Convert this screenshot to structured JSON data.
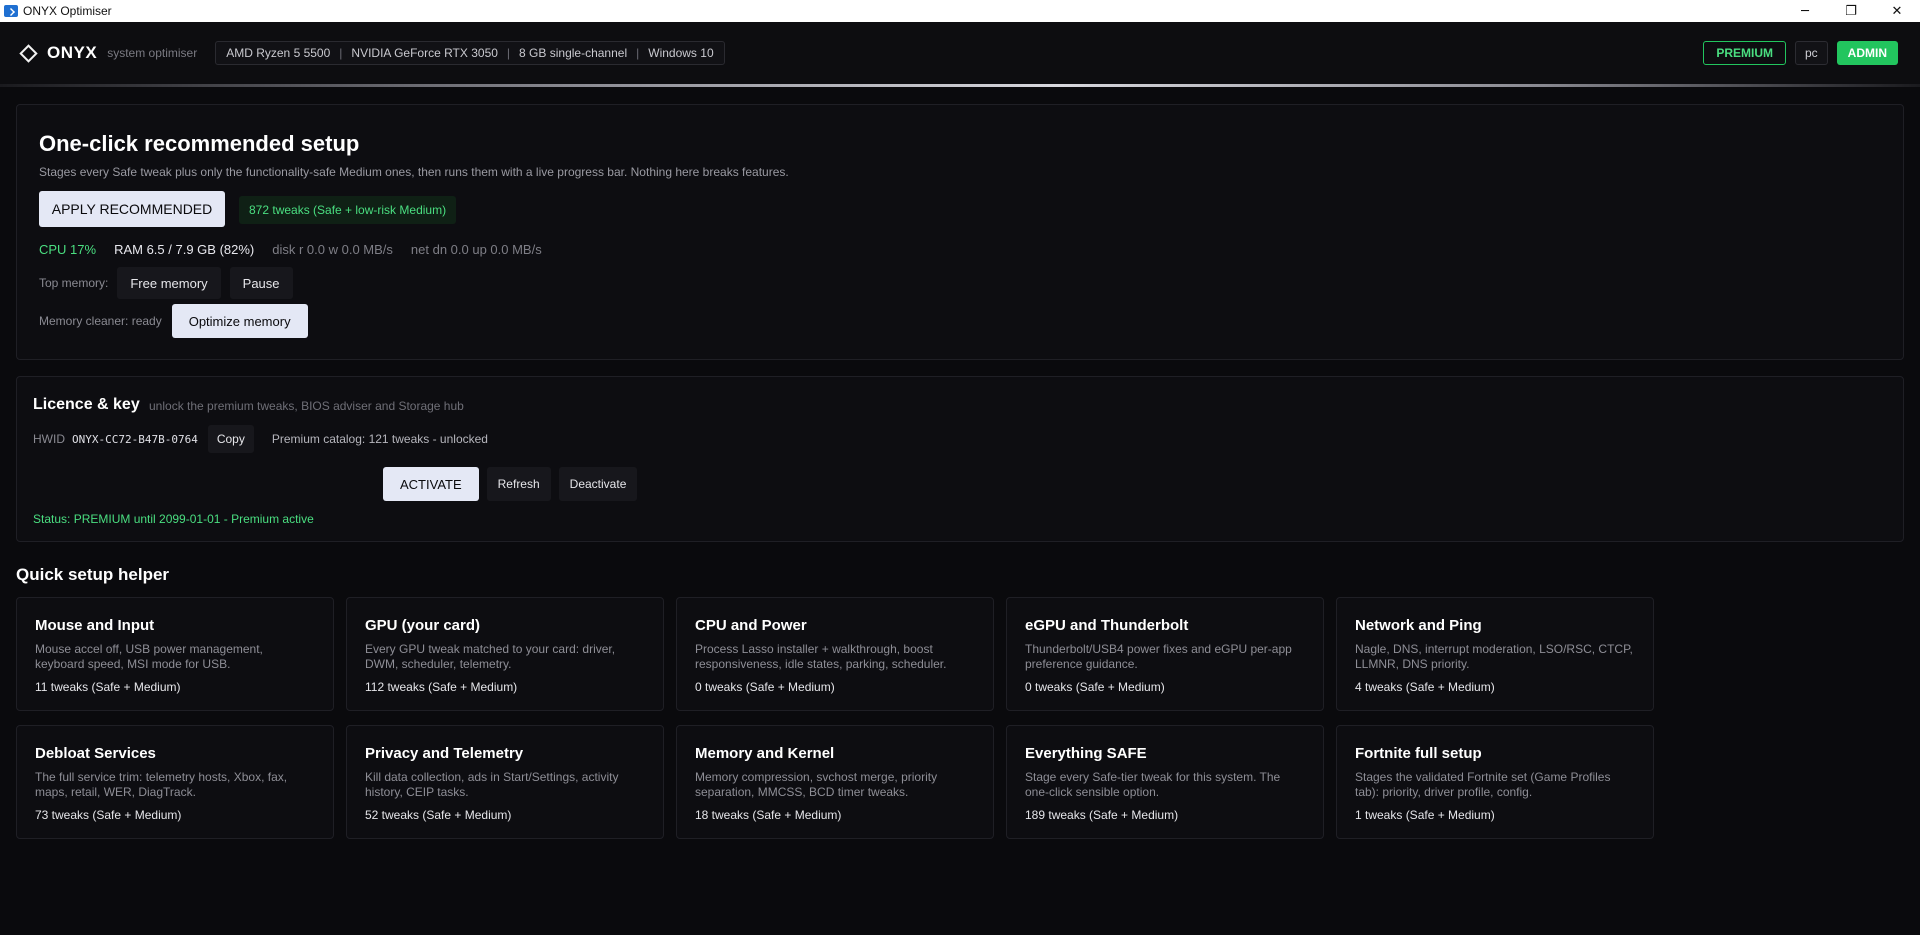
{
  "window": {
    "title": "ONYX Optimiser",
    "controls": [
      "─",
      "❐",
      "✕"
    ]
  },
  "header": {
    "brand": "ONYX",
    "tagline": "system optimiser",
    "sysinfo": [
      "AMD Ryzen 5 5500",
      "NVIDIA GeForce RTX 3050",
      "8 GB single-channel",
      "Windows 10"
    ],
    "sep": "|",
    "premium_badge": "PREMIUM",
    "user_badge": "pc",
    "admin_badge": "ADMIN"
  },
  "recommended": {
    "title": "One-click recommended setup",
    "subtitle": "Stages every Safe tweak plus only the functionality-safe Medium ones, then runs them with a live progress bar. Nothing here breaks features.",
    "apply_label": "APPLY RECOMMENDED",
    "tweak_pill": "872 tweaks (Safe + low-risk Medium)",
    "cpu": "CPU 17%",
    "ram": "RAM 6.5 / 7.9 GB (82%)",
    "disk": "disk r 0.0 w 0.0 MB/s",
    "net": "net dn 0.0 up 0.0 MB/s",
    "top_memory_label": "Top memory:",
    "free_memory_label": "Free memory",
    "pause_label": "Pause",
    "cleaner_label": "Memory cleaner: ready",
    "optimize_label": "Optimize memory"
  },
  "licence": {
    "title": "Licence & key",
    "subtitle": "unlock the premium tweaks, BIOS adviser and Storage hub",
    "hwid_label": "HWID",
    "hwid_value": "ONYX-CC72-B47B-0764",
    "copy_label": "Copy",
    "catalog": "Premium catalog: 121 tweaks - unlocked",
    "activate_label": "ACTIVATE",
    "refresh_label": "Refresh",
    "deactivate_label": "Deactivate",
    "status": "Status: PREMIUM until 2099-01-01 - Premium active"
  },
  "quick_setup": {
    "title": "Quick setup helper",
    "cards": [
      {
        "title": "Mouse and Input",
        "desc": "Mouse accel off, USB power management, keyboard speed, MSI mode for USB.",
        "count": "11 tweaks (Safe + Medium)"
      },
      {
        "title": "GPU (your card)",
        "desc": "Every GPU tweak matched to your card: driver, DWM, scheduler, telemetry.",
        "count": "112 tweaks (Safe + Medium)"
      },
      {
        "title": "CPU and Power",
        "desc": "Process Lasso installer + walkthrough, boost responsiveness, idle states, parking, scheduler.",
        "count": "0 tweaks (Safe + Medium)"
      },
      {
        "title": "eGPU and Thunderbolt",
        "desc": "Thunderbolt/USB4 power fixes and eGPU per-app preference guidance.",
        "count": "0 tweaks (Safe + Medium)"
      },
      {
        "title": "Network and Ping",
        "desc": "Nagle, DNS, interrupt moderation, LSO/RSC, CTCP, LLMNR, DNS priority.",
        "count": "4 tweaks (Safe + Medium)"
      },
      {
        "title": "Debloat Services",
        "desc": "The full service trim: telemetry hosts, Xbox, fax, maps, retail, WER, DiagTrack.",
        "count": "73 tweaks (Safe + Medium)"
      },
      {
        "title": "Privacy and Telemetry",
        "desc": "Kill data collection, ads in Start/Settings, activity history, CEIP tasks.",
        "count": "52 tweaks (Safe + Medium)"
      },
      {
        "title": "Memory and Kernel",
        "desc": "Memory compression, svchost merge, priority separation, MMCSS, BCD timer tweaks.",
        "count": "18 tweaks (Safe + Medium)"
      },
      {
        "title": "Everything SAFE",
        "desc": "Stage every Safe-tier tweak for this system. The one-click sensible option.",
        "count": "189 tweaks (Safe + Medium)"
      },
      {
        "title": "Fortnite full setup",
        "desc": "Stages the validated Fortnite set (Game Profiles tab): priority, driver profile, config.",
        "count": "1 tweaks (Safe + Medium)"
      }
    ]
  }
}
